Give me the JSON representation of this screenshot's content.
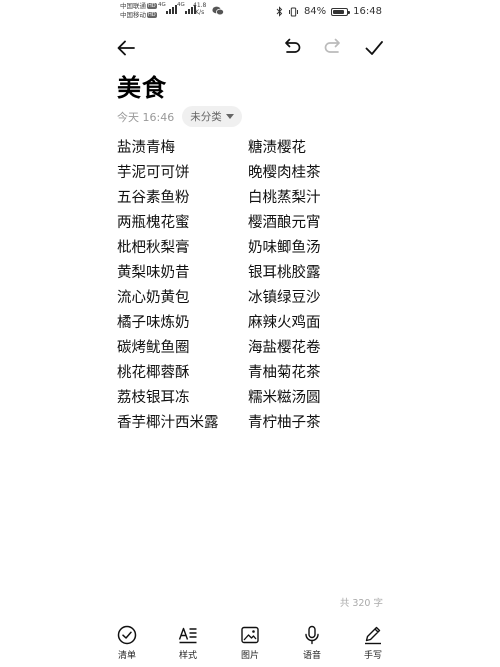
{
  "status_bar": {
    "carrier_1": "中国联通",
    "carrier_1_tag": "HD",
    "carrier_2": "中国移动",
    "carrier_2_tag": "HD",
    "signal_1_label": "4G",
    "signal_2_label": "4G",
    "net_speed_value": "41.8",
    "net_speed_unit": "K/s",
    "battery": "84%",
    "battery_level": 0.84,
    "time": "16:48"
  },
  "note": {
    "title": "美食",
    "time": "今天 16:46",
    "category": "未分类",
    "left_items": [
      "盐渍青梅",
      "芋泥可可饼",
      "五谷素鱼粉",
      "两瓶槐花蜜",
      "枇杷秋梨膏",
      "黄梨味奶昔",
      "流心奶黄包",
      "橘子味炼奶",
      "碳烤鱿鱼圈",
      "桃花椰蓉酥",
      "荔枝银耳冻",
      "香芋椰汁西米露"
    ],
    "right_items": [
      "糖渍樱花",
      "晚樱肉桂茶",
      "白桃蒸梨汁",
      "樱酒酿元宵",
      "奶味鲫鱼汤",
      "银耳桃胶露",
      "冰镇绿豆沙",
      "麻辣火鸡面",
      "海盐樱花卷",
      "青柚菊花茶",
      "糯米糍汤圆",
      "青柠柚子茶"
    ],
    "word_count": "共 320 字"
  },
  "bottom_bar": {
    "checklist": "清单",
    "style": "样式",
    "image": "图片",
    "voice": "语音",
    "handwrite": "手写"
  },
  "icons": [
    "back-arrow-icon",
    "undo-icon",
    "redo-icon",
    "check-icon",
    "checklist-icon",
    "text-style-icon",
    "image-icon",
    "microphone-icon",
    "pen-icon",
    "bluetooth-icon",
    "vibrate-icon",
    "wechat-icon"
  ]
}
